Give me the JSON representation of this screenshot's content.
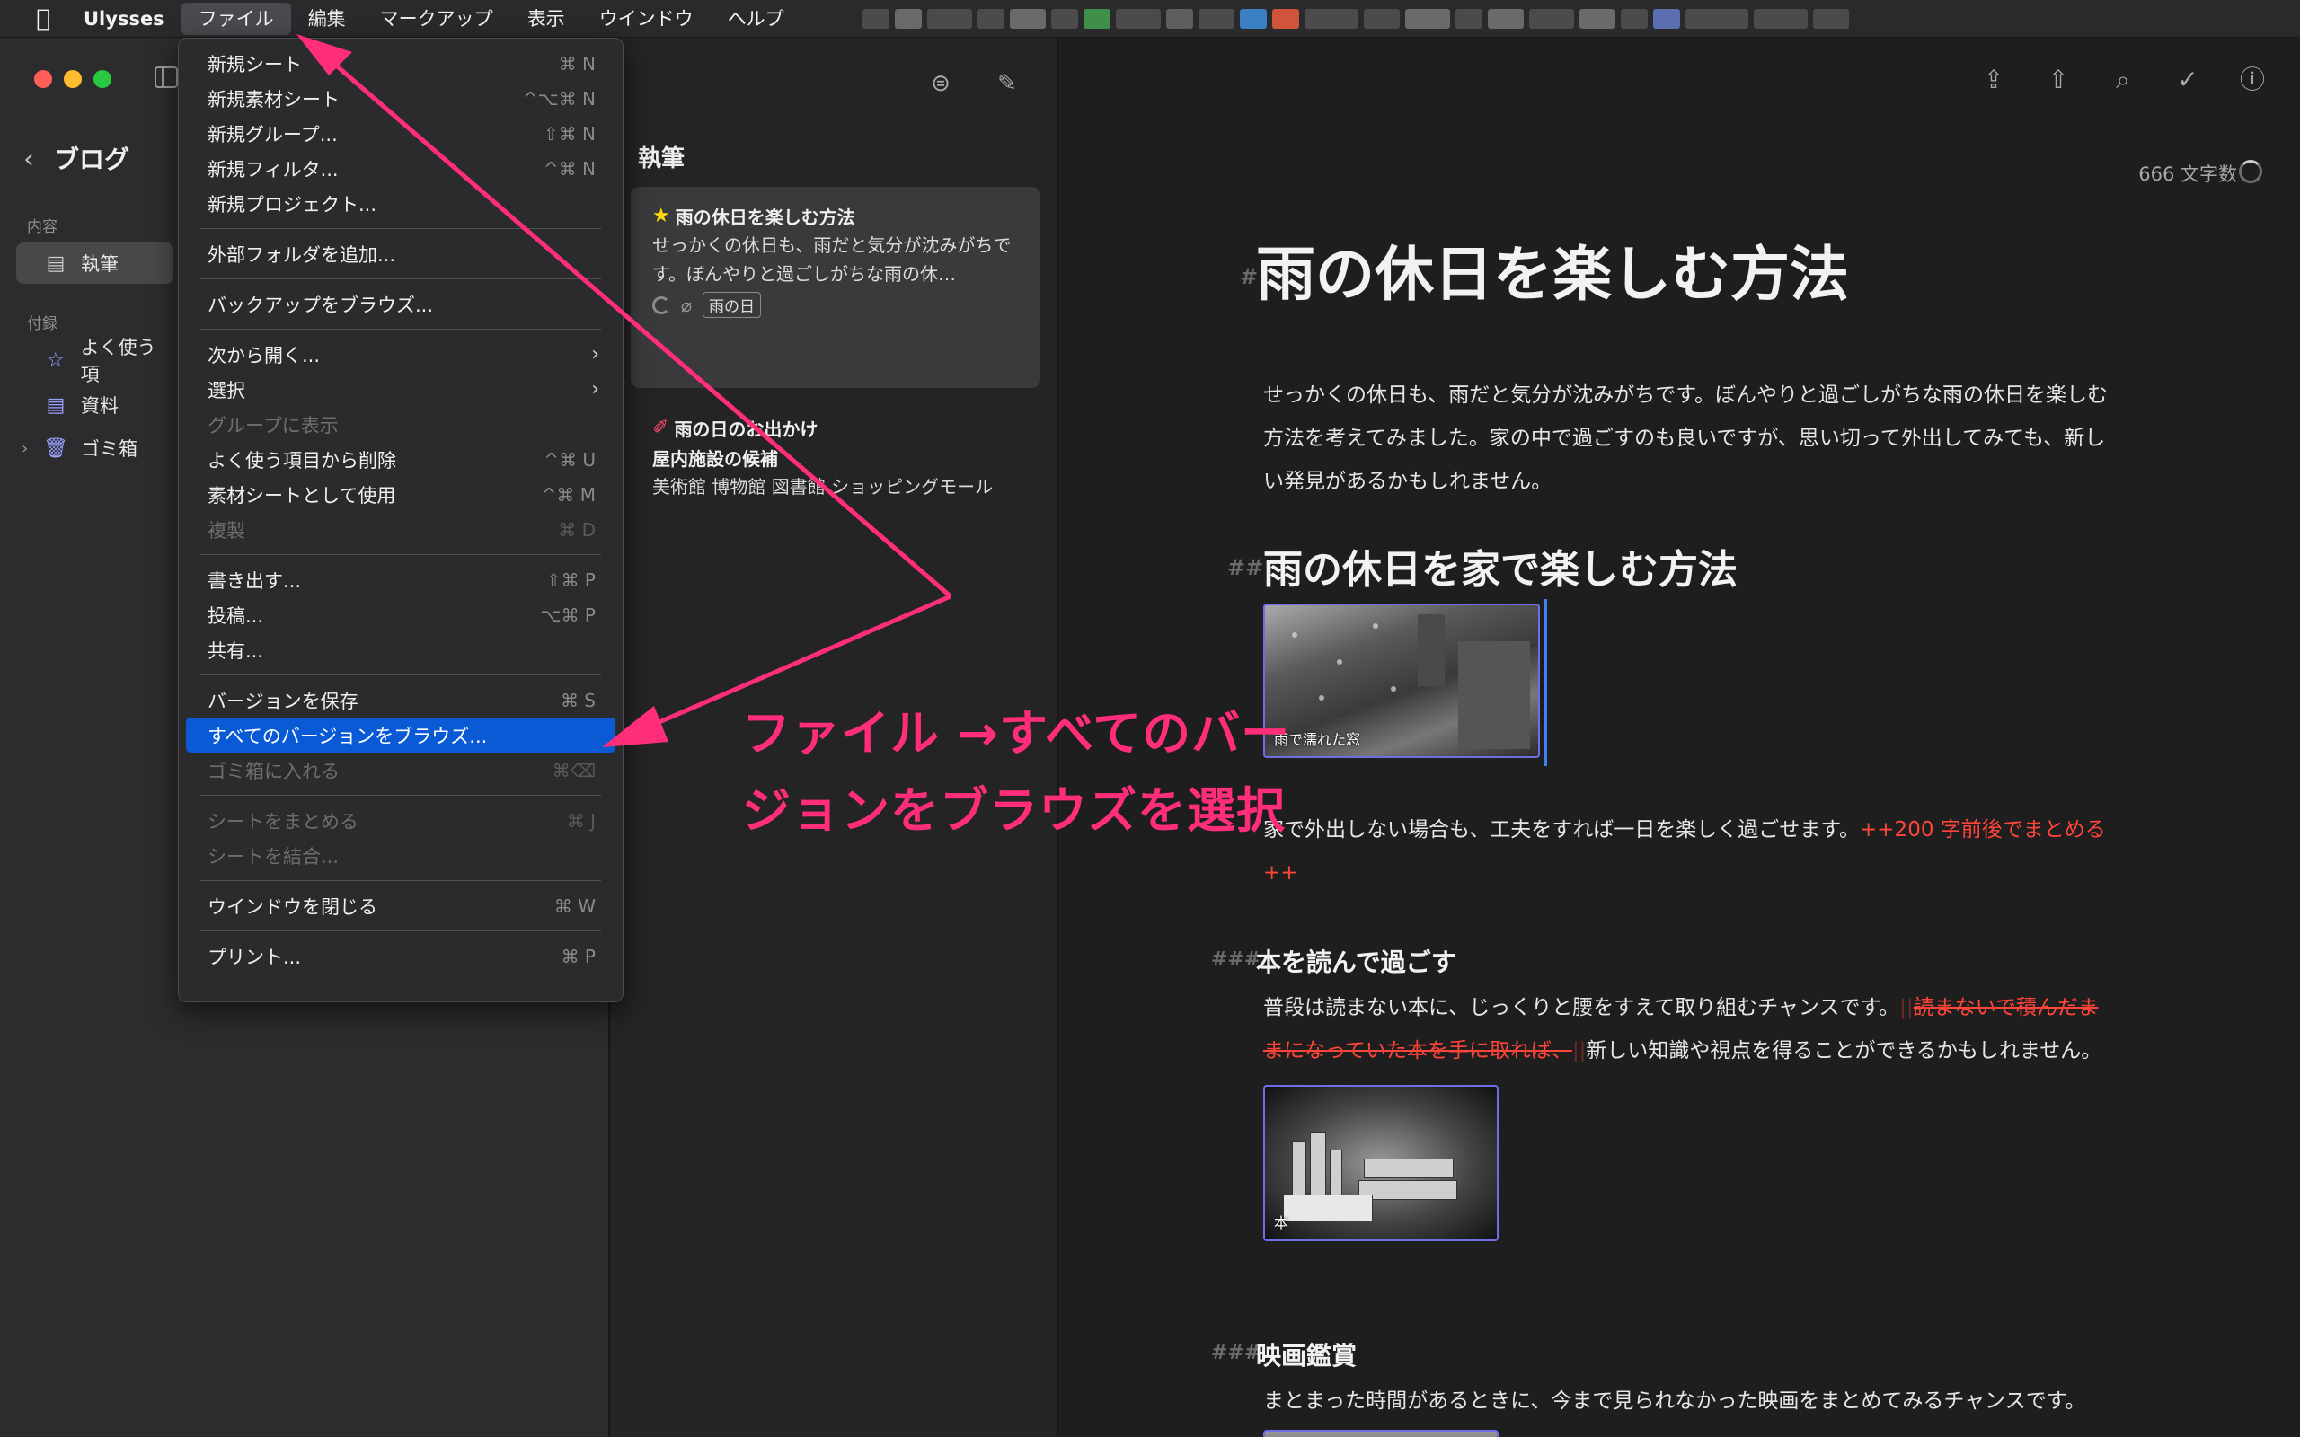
{
  "menubar": {
    "app_name": "Ulysses",
    "items": [
      "ファイル",
      "編集",
      "マークアップ",
      "表示",
      "ウインドウ",
      "ヘルプ"
    ]
  },
  "file_menu": {
    "items": [
      {
        "label": "新規シート",
        "shortcut": "⌘ N",
        "disabled": false
      },
      {
        "label": "新規素材シート",
        "shortcut": "^⌥⌘ N",
        "disabled": false
      },
      {
        "label": "新規グループ...",
        "shortcut": "⇧⌘ N",
        "disabled": false
      },
      {
        "label": "新規フィルタ...",
        "shortcut": "^⌘ N",
        "disabled": false
      },
      {
        "label": "新規プロジェクト...",
        "shortcut": "",
        "disabled": false
      },
      {
        "label": "外部フォルダを追加...",
        "shortcut": "",
        "disabled": false
      },
      {
        "label": "バックアップをブラウズ...",
        "shortcut": "",
        "disabled": false
      },
      {
        "label": "次から開く...",
        "shortcut": "",
        "disabled": false,
        "submenu": true
      },
      {
        "label": "選択",
        "shortcut": "",
        "disabled": false,
        "submenu": true
      },
      {
        "label": "グループに表示",
        "shortcut": "",
        "disabled": true
      },
      {
        "label": "よく使う項目から削除",
        "shortcut": "^⌘ U",
        "disabled": false
      },
      {
        "label": "素材シートとして使用",
        "shortcut": "^⌘ M",
        "disabled": false
      },
      {
        "label": "複製",
        "shortcut": "⌘ D",
        "disabled": true
      },
      {
        "label": "書き出す...",
        "shortcut": "⇧⌘ P",
        "disabled": false
      },
      {
        "label": "投稿...",
        "shortcut": "⌥⌘ P",
        "disabled": false
      },
      {
        "label": "共有...",
        "shortcut": "",
        "disabled": false
      },
      {
        "label": "バージョンを保存",
        "shortcut": "⌘ S",
        "disabled": false
      },
      {
        "label": "すべてのバージョンをブラウズ...",
        "shortcut": "",
        "disabled": false,
        "highlighted": true
      },
      {
        "label": "ゴミ箱に入れる",
        "shortcut": "⌘⌫",
        "disabled": true
      },
      {
        "label": "シートをまとめる",
        "shortcut": "⌘ J",
        "disabled": true
      },
      {
        "label": "シートを結合...",
        "shortcut": "",
        "disabled": true
      },
      {
        "label": "ウインドウを閉じる",
        "shortcut": "⌘ W",
        "disabled": false
      },
      {
        "label": "プリント...",
        "shortcut": "⌘ P",
        "disabled": false
      }
    ]
  },
  "sidebar": {
    "project_title": "ブログ",
    "section_content": "内容",
    "section_attachments": "付録",
    "items": [
      {
        "label": "執筆",
        "icon": "sheet-icon"
      },
      {
        "label": "よく使う項",
        "icon": "star-icon"
      },
      {
        "label": "資料",
        "icon": "sheet-icon"
      },
      {
        "label": "ゴミ箱",
        "icon": "trash-icon"
      }
    ]
  },
  "sheet_list": {
    "title": "執筆",
    "sheets": [
      {
        "title": "雨の休日を楽しむ方法",
        "excerpt": "せっかくの休日も、雨だと気分が沈みがちです。ぼんやりと過ごしがちな雨の休…",
        "tag": "雨の日"
      },
      {
        "title": "雨の日のお出かけ",
        "subtitle": "屋内施設の候補",
        "excerpt": "美術館 博物館 図書館 ショッピングモール"
      }
    ]
  },
  "editor": {
    "word_count": "666 文字数",
    "h1_mark": "#",
    "h1": "雨の休日を楽しむ方法",
    "intro": "せっかくの休日も、雨だと気分が沈みがちです。ぼんやりと過ごしがちな雨の休日を楽しむ方法を考えてみました。家の中で過ごすのも良いですが、思い切って外出してみても、新しい発見があるかもしれません。",
    "h2_mark": "##",
    "h2": "雨の休日を家で楽しむ方法",
    "image1_caption": "雨で濡れた窓",
    "p2_main": "家で外出しない場合も、工夫をすれば一日を楽しく過ごせます。",
    "p2_note": "++200 字前後でまとめる ++",
    "h3a_mark": "###",
    "h3a": "本を読んで過ごす",
    "p3_start": "普段は読まない本に、じっくりと腰をすえて取り組むチャンスです。",
    "p3_delete_open": "||",
    "p3_deleted": "読まないで積んだままになっていた本を手に取れば、",
    "p3_delete_close": "||",
    "p3_end": "新しい知識や視点を得ることができるかもしれません。",
    "image2_caption": "本",
    "h3b_mark": "###",
    "h3b": "映画鑑賞",
    "p4": "まとまった時間があるときに、今まで見られなかった映画をまとめてみるチャンスです。"
  },
  "annotation": {
    "line1": "ファイル →すべてのバー",
    "line2": "ジョンをブラウズを選択",
    "color": "#ff2d7a"
  }
}
